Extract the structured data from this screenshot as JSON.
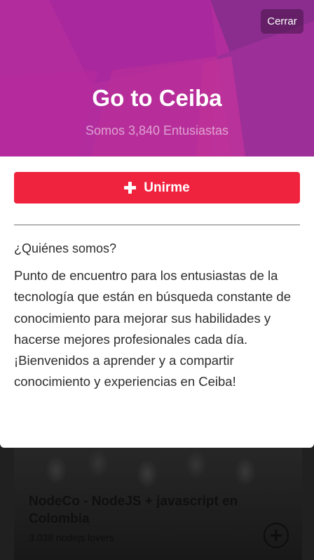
{
  "modal": {
    "close_label": "Cerrar",
    "title": "Go to Ceiba",
    "members": "Somos 3,840 Entusiastas",
    "join_label": "Unirme",
    "about_heading": "¿Quiénes somos?",
    "about_text": "Punto de encuentro para los entusiastas de la tecnología que están en búsqueda constante de conocimiento para mejorar sus habilidades y hacerse mejores profesionales cada día. ¡Bienvenidos a aprender y a compartir conocimiento y experiencias en Ceiba!"
  },
  "background_card": {
    "title": "NodeCo - NodeJS + javascript en Colombia",
    "subtitle": "3.038 nodejs lovers",
    "icon": "plus-circle-icon"
  },
  "colors": {
    "hero": "#b12d9d",
    "join_button": "#f0233f",
    "text": "#2e2e2e"
  }
}
